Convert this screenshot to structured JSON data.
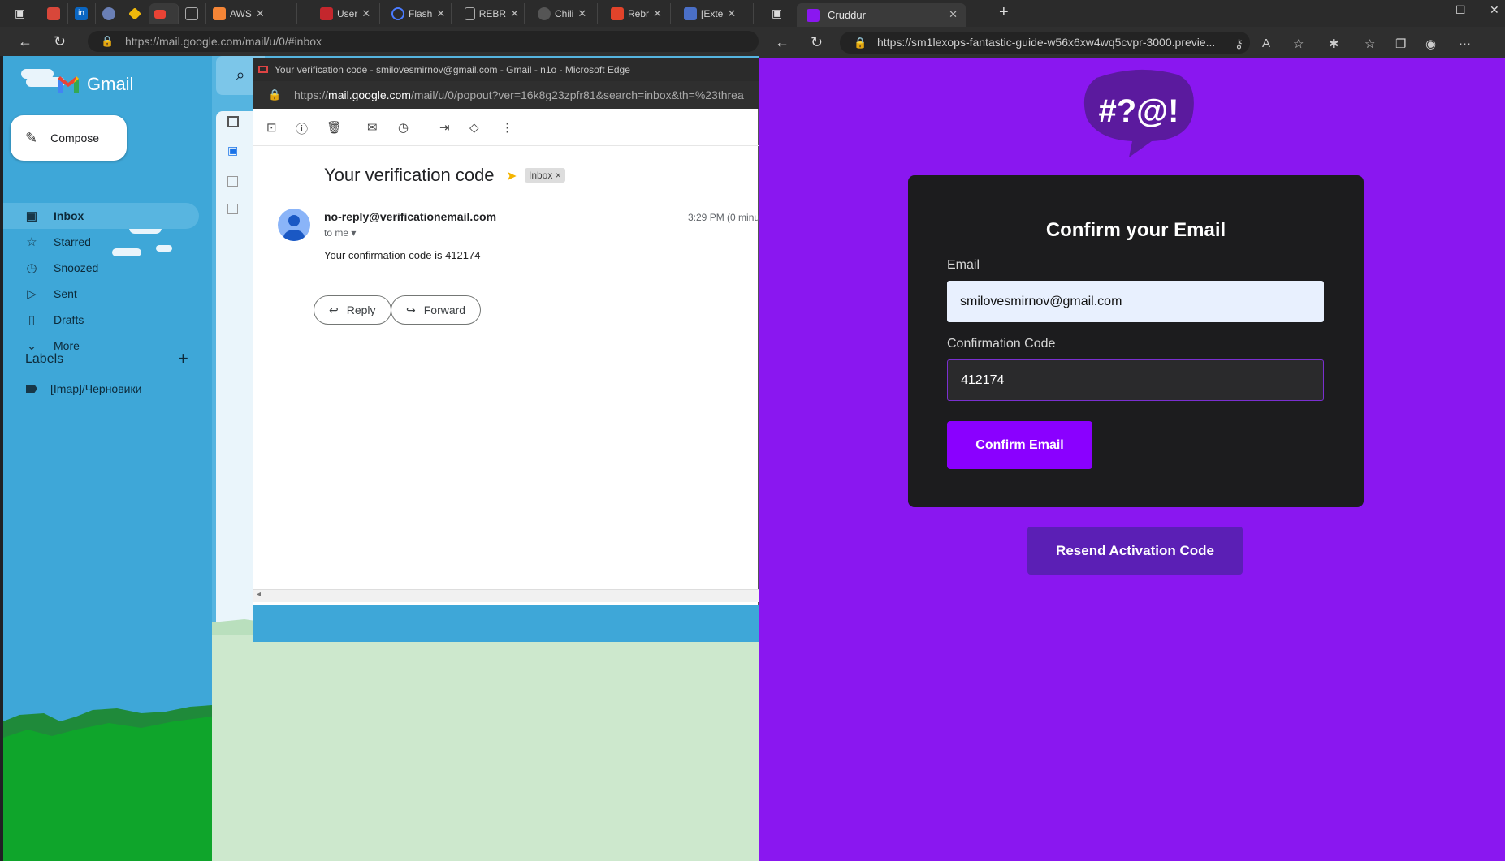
{
  "left_browser": {
    "tabs": [
      {
        "label": "",
        "icon": "chili-icon"
      },
      {
        "label": "",
        "icon": "linkedin-icon"
      },
      {
        "label": "",
        "icon": "generic-icon"
      },
      {
        "label": "",
        "icon": "binance-icon"
      },
      {
        "label": "",
        "icon": "gmail-icon"
      },
      {
        "label": "",
        "icon": "page-icon"
      },
      {
        "label": "AWS",
        "icon": "aws-icon"
      },
      {
        "label": "User",
        "icon": "user-icon"
      },
      {
        "label": "Flash",
        "icon": "flash-icon"
      },
      {
        "label": "REBR",
        "icon": "rebr-icon"
      },
      {
        "label": "Chili",
        "icon": "chili-icon"
      },
      {
        "label": "Rebr",
        "icon": "gitlab-icon"
      },
      {
        "label": "[Exte",
        "icon": "doc-icon"
      }
    ],
    "url": "https://mail.google.com/mail/u/0/#inbox"
  },
  "gmail": {
    "app_name": "Gmail",
    "compose_label": "Compose",
    "nav": [
      {
        "label": "Inbox",
        "icon": "inbox-icon",
        "active": true
      },
      {
        "label": "Starred",
        "icon": "star-icon"
      },
      {
        "label": "Snoozed",
        "icon": "clock-icon"
      },
      {
        "label": "Sent",
        "icon": "send-icon"
      },
      {
        "label": "Drafts",
        "icon": "draft-icon"
      },
      {
        "label": "More",
        "icon": "chevron-down-icon"
      }
    ],
    "labels_heading": "Labels",
    "labels": [
      {
        "label": "[Imap]/Черновики"
      }
    ]
  },
  "popup": {
    "window_title": "Your verification code - smilovesmirnov@gmail.com - Gmail - n1o - Microsoft Edge",
    "url_prefix": "https://",
    "url_host": "mail.google.com",
    "url_rest": "/mail/u/0/popout?ver=16k8g23zpfr81&search=inbox&th=%23threa",
    "subject": "Your verification code",
    "inbox_chip": "Inbox",
    "sender": "no-reply@verificationemail.com",
    "to_me": "to me",
    "time": "3:29 PM (0 minu",
    "body": "Your confirmation code is 412174",
    "reply_label": "Reply",
    "forward_label": "Forward"
  },
  "right_browser": {
    "tab_title": "Cruddur",
    "url": "https://sm1lexops-fantastic-guide-w56x6xw4wq5cvpr-3000.previe..."
  },
  "cruddur": {
    "logo_text": "#?@!",
    "card_title": "Confirm your Email",
    "email_label": "Email",
    "email_value": "smilovesmirnov@gmail.com",
    "code_label": "Confirmation Code",
    "code_value": "412174",
    "confirm_label": "Confirm Email",
    "resend_label": "Resend Activation Code"
  },
  "colors": {
    "brand_purple": "#8a17f0",
    "button_purple": "#8a00ff",
    "resend_purple": "#5b1fb5",
    "card_bg": "#1c1c1e",
    "gmail_bg": "#3ea7d8"
  }
}
